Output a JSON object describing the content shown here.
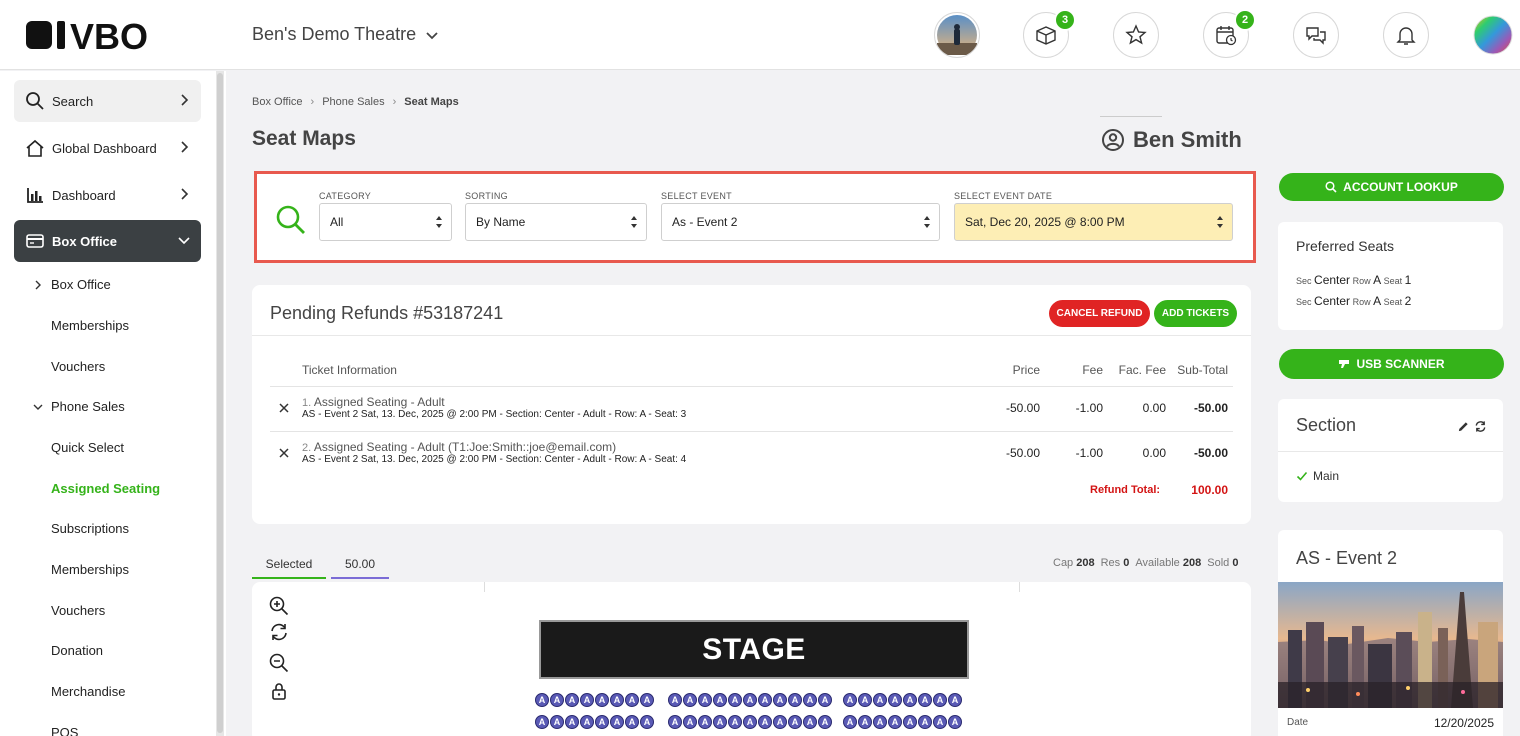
{
  "header": {
    "brand": "VBO",
    "theatre_name": "Ben's Demo Theatre",
    "badges": {
      "tickets": "3",
      "calendar": "2"
    }
  },
  "sidebar": {
    "search": "Search",
    "global_dashboard": "Global Dashboard",
    "dashboard": "Dashboard",
    "box_office_section": "Box Office",
    "sub_box_office": "Box Office",
    "memberships_1": "Memberships",
    "vouchers_1": "Vouchers",
    "phone_sales": "Phone Sales",
    "quick_select": "Quick Select",
    "assigned_seating": "Assigned Seating",
    "subscriptions": "Subscriptions",
    "memberships_2": "Memberships",
    "vouchers_2": "Vouchers",
    "donation": "Donation",
    "merchandise": "Merchandise",
    "pos": "POS"
  },
  "breadcrumb": {
    "item1": "Box Office",
    "item2": "Phone Sales",
    "current": "Seat Maps"
  },
  "page": {
    "title": "Seat Maps",
    "user_name": "Ben Smith"
  },
  "filters": {
    "category_label": "CATEGORY",
    "category_value": "All",
    "sorting_label": "SORTING",
    "sorting_value": "By Name",
    "event_label": "SELECT EVENT",
    "event_value": "As - Event 2",
    "date_label": "SELECT EVENT DATE",
    "date_value": "Sat, Dec 20, 2025 @ 8:00 PM"
  },
  "refunds": {
    "title": "Pending Refunds #53187241",
    "cancel_button": "CANCEL REFUND",
    "add_button": "ADD TICKETS",
    "columns": {
      "info": "Ticket Information",
      "price": "Price",
      "fee": "Fee",
      "fac_fee": "Fac. Fee",
      "subtotal": "Sub-Total"
    },
    "rows": [
      {
        "num": "1.",
        "title": "Assigned Seating - Adult",
        "desc": "AS - Event 2 Sat, 13. Dec, 2025 @ 2:00 PM - Section: Center - Adult - Row: A - Seat: 3",
        "price": "-50.00",
        "fee": "-1.00",
        "fac_fee": "0.00",
        "subtotal": "-50.00"
      },
      {
        "num": "2.",
        "title": "Assigned Seating - Adult (T1:Joe:Smith::joe@email.com)",
        "desc": "AS - Event 2 Sat, 13. Dec, 2025 @ 2:00 PM - Section: Center - Adult - Row: A - Seat: 4",
        "price": "-50.00",
        "fee": "-1.00",
        "fac_fee": "0.00",
        "subtotal": "-50.00"
      }
    ],
    "total_label": "Refund Total:",
    "total_value": "100.00"
  },
  "map_tabs": {
    "selected": "Selected",
    "price": "50.00"
  },
  "stats": {
    "cap_label": "Cap",
    "cap": "208",
    "res_label": "Res",
    "res": "0",
    "avail_label": "Available",
    "avail": "208",
    "sold_label": "Sold",
    "sold": "0"
  },
  "seatmap": {
    "stage": "STAGE",
    "seat_letter": "A"
  },
  "right": {
    "account_lookup": "ACCOUNT LOOKUP",
    "preferred_title": "Preferred Seats",
    "sec_label": "Sec",
    "row_label": "Row",
    "seat_label": "Seat",
    "pref1": {
      "sec": "Center",
      "row": "A",
      "seat": "1"
    },
    "pref2": {
      "sec": "Center",
      "row": "A",
      "seat": "2"
    },
    "usb_scanner": "USB SCANNER",
    "section_title": "Section",
    "section_item": "Main",
    "event_title": "AS - Event 2",
    "date_label": "Date",
    "date_value": "12/20/2025"
  },
  "colors": {
    "accent_green": "#35b31a",
    "danger_red": "#e02424",
    "highlight_red": "#e8594e",
    "dark_active": "#3b4043",
    "date_yellow": "#fdeeb5"
  }
}
